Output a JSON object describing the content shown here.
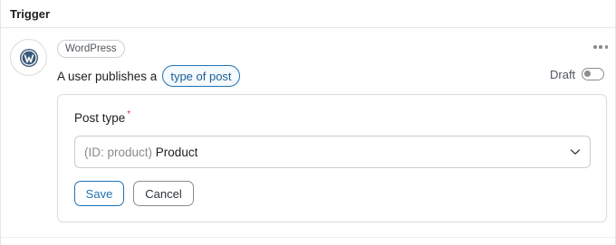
{
  "header": {
    "title": "Trigger"
  },
  "trigger": {
    "integration": "WordPress",
    "sentence_prefix": "A user publishes a",
    "token_label": "type of post",
    "status_label": "Draft"
  },
  "form": {
    "field_label": "Post type",
    "required_marker": "*",
    "select": {
      "id_prefix": "(ID: product)",
      "value": "Product"
    },
    "save_label": "Save",
    "cancel_label": "Cancel"
  },
  "icons": [
    "wordpress-icon",
    "more-options-icon",
    "chevron-down-icon"
  ],
  "colors": {
    "accent": "#2271b1",
    "required": "#d63638",
    "wordpress": "#3c5a78"
  }
}
